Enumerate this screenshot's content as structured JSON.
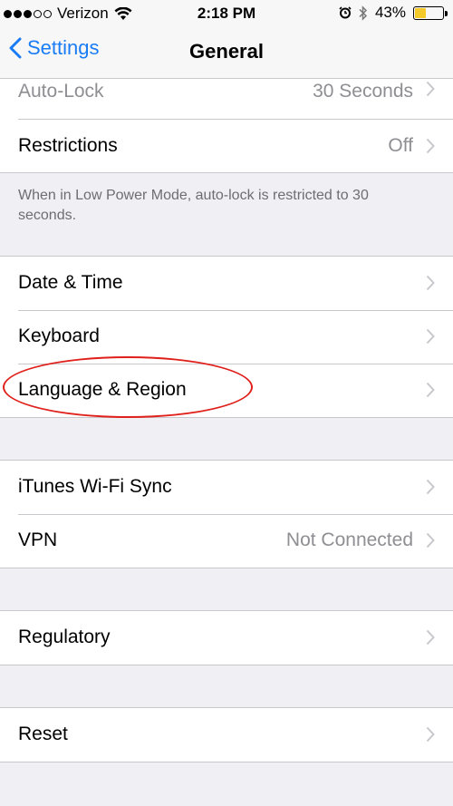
{
  "status_bar": {
    "carrier": "Verizon",
    "time": "2:18 PM",
    "battery_percent": "43%",
    "battery_level": 0.43,
    "signal_filled": 3,
    "signal_total": 5,
    "icons": [
      "wifi-icon",
      "alarm-icon",
      "bluetooth-icon",
      "battery-icon"
    ]
  },
  "nav": {
    "back_label": "Settings",
    "title": "General"
  },
  "groups": [
    {
      "rows": [
        {
          "label": "Auto-Lock",
          "value": "30 Seconds"
        },
        {
          "label": "Restrictions",
          "value": "Off"
        }
      ],
      "footer": "When in Low Power Mode, auto-lock is restricted to 30 seconds."
    },
    {
      "rows": [
        {
          "label": "Date & Time",
          "value": ""
        },
        {
          "label": "Keyboard",
          "value": ""
        },
        {
          "label": "Language & Region",
          "value": ""
        }
      ]
    },
    {
      "rows": [
        {
          "label": "iTunes Wi-Fi Sync",
          "value": ""
        },
        {
          "label": "VPN",
          "value": "Not Connected"
        }
      ]
    },
    {
      "rows": [
        {
          "label": "Regulatory",
          "value": ""
        }
      ]
    },
    {
      "rows": [
        {
          "label": "Reset",
          "value": ""
        }
      ]
    }
  ],
  "colors": {
    "accent": "#1a7cf5",
    "annotation": "#e0201b",
    "battery": "#f4c92a"
  }
}
